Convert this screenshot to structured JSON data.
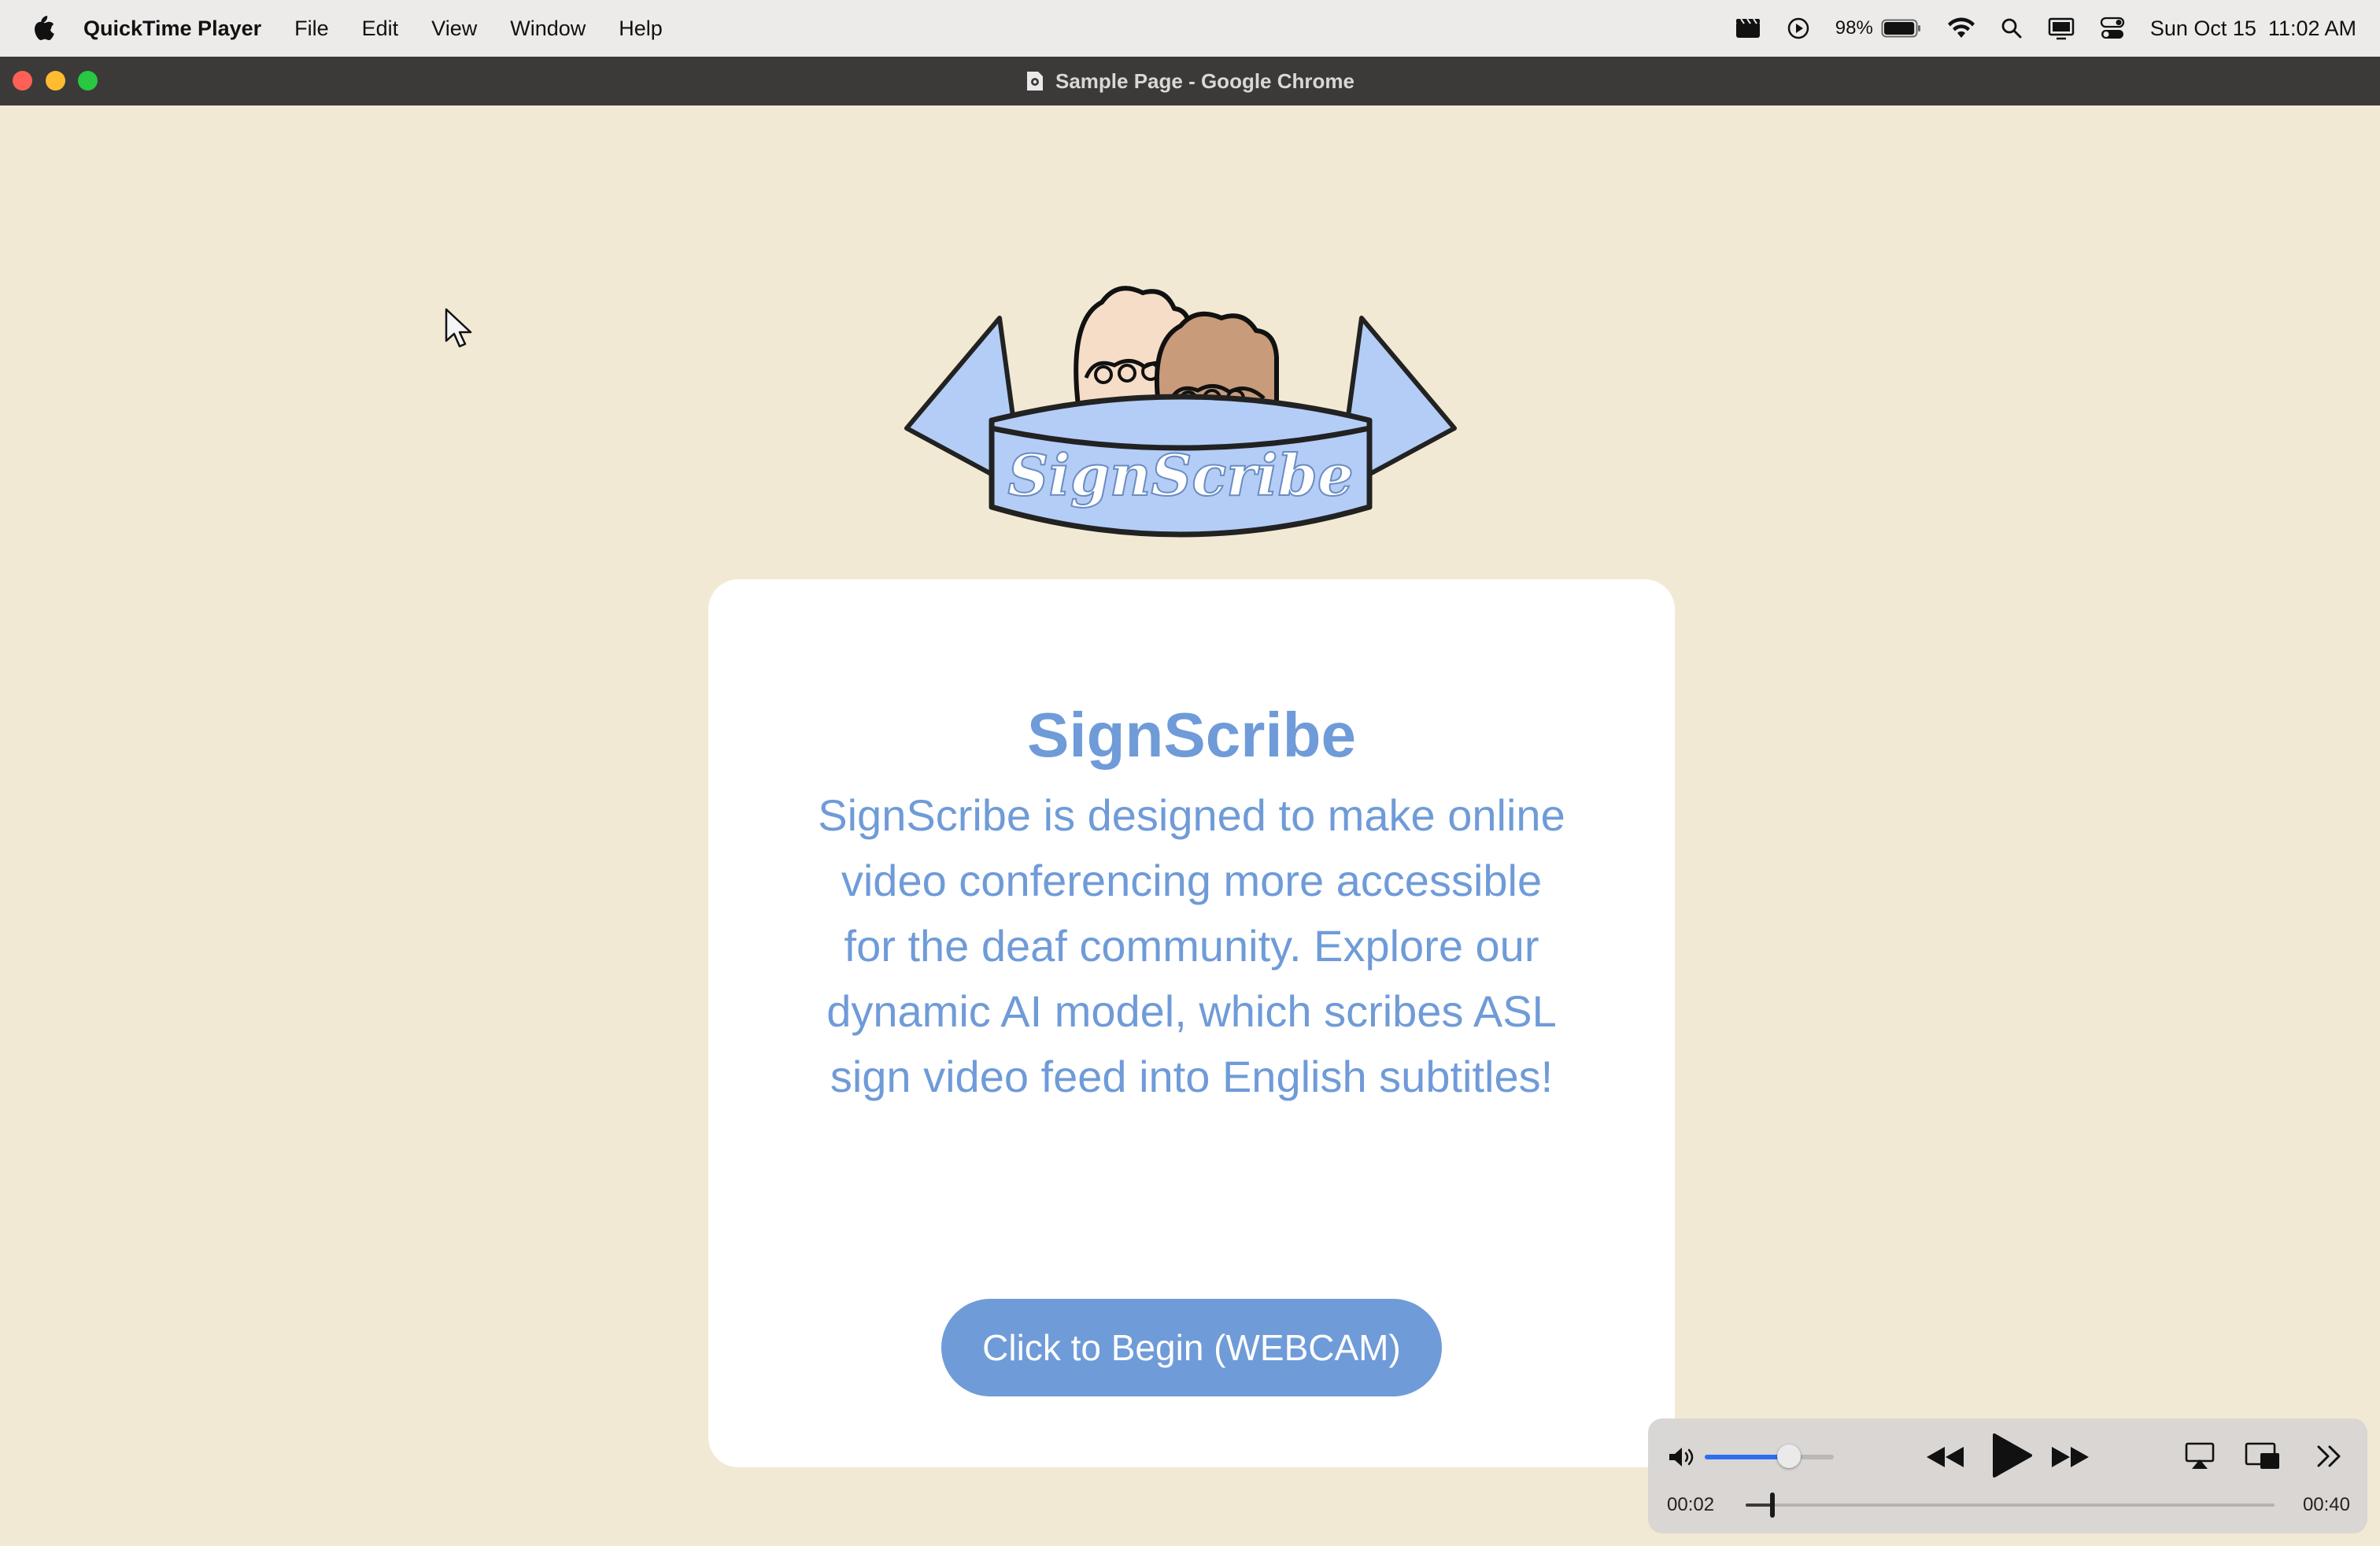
{
  "menubar": {
    "app_name": "QuickTime Player",
    "menus": [
      "File",
      "Edit",
      "View",
      "Window",
      "Help"
    ],
    "battery_percent": "98%",
    "battery_level": 0.98,
    "datetime": "Sun Oct 15  11:02 AM"
  },
  "window": {
    "title": "Sample Page - Google Chrome"
  },
  "page": {
    "logo_text": "SignScribe",
    "heading": "SignScribe",
    "description": "SignScribe is designed to make online video conferencing more accessible for the deaf community. Explore our dynamic AI model, which scribes ASL sign video feed into English subtitles!",
    "cta_label": "Click to Begin (WEBCAM)"
  },
  "player": {
    "volume_level": 0.65,
    "current_time": "00:02",
    "total_time": "00:40",
    "progress": 0.05
  },
  "colors": {
    "page_background": "#f2e9d4",
    "accent": "#6f9bd8",
    "volume_accent": "#2d6ef0"
  }
}
